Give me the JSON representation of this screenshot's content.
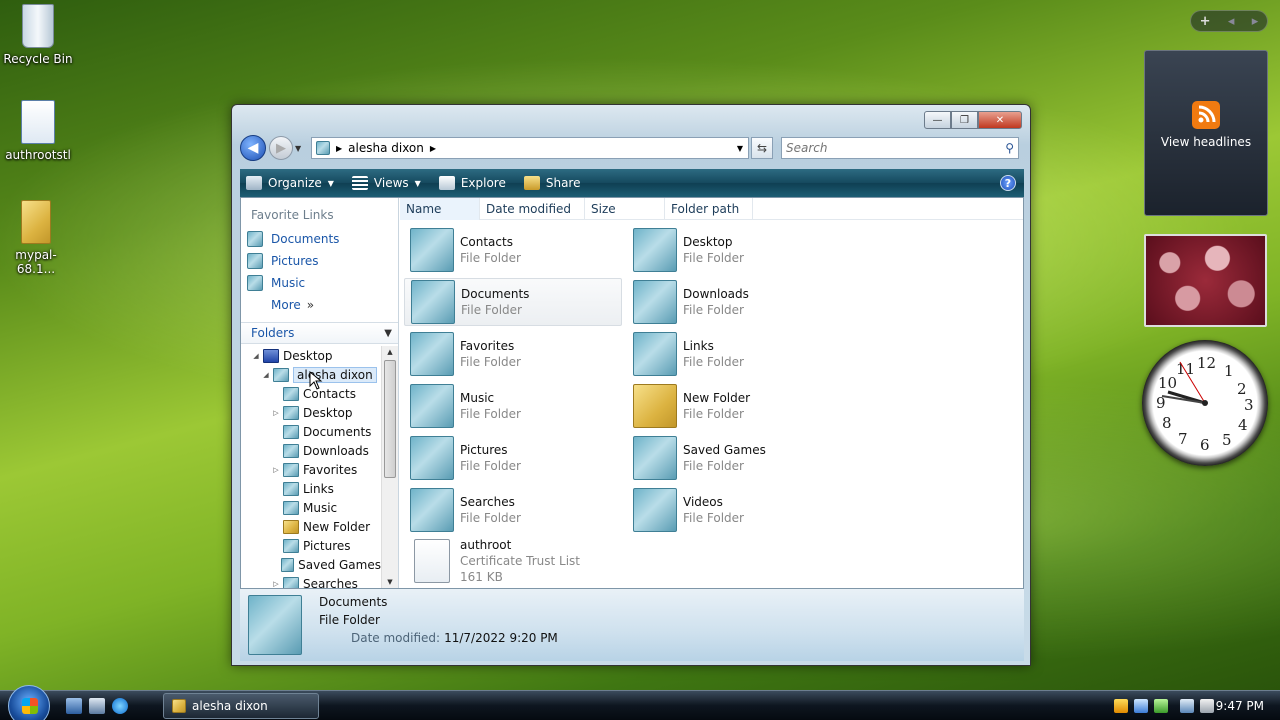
{
  "desktop": {
    "icons": [
      {
        "label": "Recycle Bin"
      },
      {
        "label": "authrootstl"
      },
      {
        "label": "mypal-68.1..."
      }
    ]
  },
  "gadgets": {
    "controls": [
      "+",
      "◂",
      "▸"
    ],
    "feed": {
      "label": "View headlines",
      "icon": "rss-icon"
    },
    "clock_numbers": [
      "12",
      "1",
      "2",
      "3",
      "4",
      "5",
      "6",
      "7",
      "8",
      "9",
      "10",
      "11"
    ]
  },
  "window": {
    "caption_buttons": {
      "minimize": "—",
      "maximize": "❐",
      "close": "✕"
    },
    "address": {
      "segments": [
        "alesha dixon"
      ]
    },
    "search": {
      "placeholder": "Search"
    },
    "toolbar": {
      "organize": "Organize",
      "views": "Views",
      "explore": "Explore",
      "share": "Share",
      "help": "?"
    },
    "nav": {
      "favorite_links_header": "Favorite Links",
      "favorites": [
        "Documents",
        "Pictures",
        "Music"
      ],
      "more": "More",
      "folders_header": "Folders",
      "tree": [
        {
          "label": "Desktop",
          "level": 0,
          "twisty": "◢"
        },
        {
          "label": "alesha dixon",
          "level": 1,
          "twisty": "◢",
          "selected": true
        },
        {
          "label": "Contacts",
          "level": 2,
          "twisty": ""
        },
        {
          "label": "Desktop",
          "level": 2,
          "twisty": "▷"
        },
        {
          "label": "Documents",
          "level": 2,
          "twisty": ""
        },
        {
          "label": "Downloads",
          "level": 2,
          "twisty": ""
        },
        {
          "label": "Favorites",
          "level": 2,
          "twisty": "▷"
        },
        {
          "label": "Links",
          "level": 2,
          "twisty": ""
        },
        {
          "label": "Music",
          "level": 2,
          "twisty": ""
        },
        {
          "label": "New Folder",
          "level": 2,
          "twisty": ""
        },
        {
          "label": "Pictures",
          "level": 2,
          "twisty": ""
        },
        {
          "label": "Saved Games",
          "level": 2,
          "twisty": ""
        },
        {
          "label": "Searches",
          "level": 2,
          "twisty": "▷"
        }
      ]
    },
    "columns": [
      "Name",
      "Date modified",
      "Size",
      "Folder path"
    ],
    "items": [
      {
        "name": "Contacts",
        "type": "File Folder",
        "icon": "contacts-folder-icon"
      },
      {
        "name": "Desktop",
        "type": "File Folder",
        "icon": "desktop-folder-icon"
      },
      {
        "name": "Documents",
        "type": "File Folder",
        "icon": "documents-folder-icon",
        "selected": true
      },
      {
        "name": "Downloads",
        "type": "File Folder",
        "icon": "downloads-folder-icon"
      },
      {
        "name": "Favorites",
        "type": "File Folder",
        "icon": "favorites-folder-icon"
      },
      {
        "name": "Links",
        "type": "File Folder",
        "icon": "links-folder-icon"
      },
      {
        "name": "Music",
        "type": "File Folder",
        "icon": "music-folder-icon"
      },
      {
        "name": "New Folder",
        "type": "File Folder",
        "icon": "new-folder-icon"
      },
      {
        "name": "Pictures",
        "type": "File Folder",
        "icon": "pictures-folder-icon"
      },
      {
        "name": "Saved Games",
        "type": "File Folder",
        "icon": "saved-games-folder-icon"
      },
      {
        "name": "Searches",
        "type": "File Folder",
        "icon": "searches-folder-icon"
      },
      {
        "name": "Videos",
        "type": "File Folder",
        "icon": "videos-folder-icon"
      },
      {
        "name": "authroot",
        "type": "Certificate Trust List",
        "size": "161 KB",
        "icon": "certificate-icon"
      }
    ],
    "details": {
      "name": "Documents",
      "type": "File Folder",
      "modified_label": "Date modified:",
      "modified_value": "11/7/2022 9:20 PM"
    }
  },
  "taskbar": {
    "task_label": "alesha dixon",
    "time": "9:47 PM"
  }
}
